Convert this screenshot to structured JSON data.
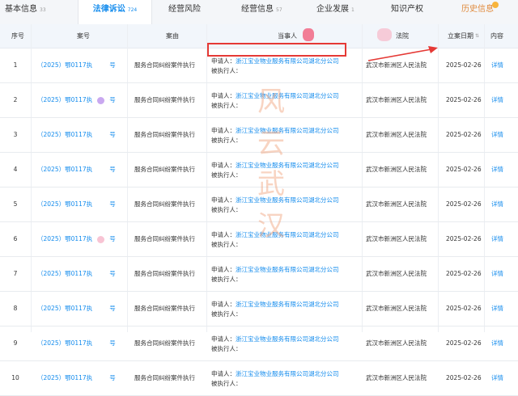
{
  "tabs": [
    {
      "label": "基本信息",
      "count": "33"
    },
    {
      "label": "法律诉讼",
      "count": "724"
    },
    {
      "label": "经营风险",
      "count": ""
    },
    {
      "label": "经营信息",
      "count": "57"
    },
    {
      "label": "企业发展",
      "count": "1"
    },
    {
      "label": "知识产权",
      "count": ""
    },
    {
      "label": "历史信息",
      "count": ""
    }
  ],
  "table": {
    "headers": {
      "index": "序号",
      "case_no": "案号",
      "cause": "案由",
      "parties": "当事人",
      "court": "法院",
      "date": "立案日期",
      "content": "内容"
    },
    "rows": [
      {
        "index": "1",
        "case_no_a": "（2025）鄂0117执",
        "case_no_b": "号",
        "cause": "服务合同纠纷案件执行",
        "applicant_label": "申请人：",
        "applicant": "浙江宝业物业服务有限公司湖北分公司",
        "respondent_label": "被执行人：",
        "respondent": "",
        "court": "武汉市新洲区人民法院",
        "date": "2025-02-26",
        "action": "详情"
      },
      {
        "index": "2",
        "case_no_a": "（2025）鄂0117执",
        "case_no_b": "号",
        "cause": "服务合同纠纷案件执行",
        "applicant_label": "申请人：",
        "applicant": "浙江宝业物业服务有限公司湖北分公司",
        "respondent_label": "被执行人：",
        "respondent": "",
        "court": "武汉市新洲区人民法院",
        "date": "2025-02-26",
        "action": "详情"
      },
      {
        "index": "3",
        "case_no_a": "（2025）鄂0117执",
        "case_no_b": "号",
        "cause": "服务合同纠纷案件执行",
        "applicant_label": "申请人：",
        "applicant": "浙江宝业物业服务有限公司湖北分公司",
        "respondent_label": "被执行人：",
        "respondent": "",
        "court": "武汉市新洲区人民法院",
        "date": "2025-02-26",
        "action": "详情"
      },
      {
        "index": "4",
        "case_no_a": "（2025）鄂0117执",
        "case_no_b": "号",
        "cause": "服务合同纠纷案件执行",
        "applicant_label": "申请人：",
        "applicant": "浙江宝业物业服务有限公司湖北分公司",
        "respondent_label": "被执行人：",
        "respondent": "",
        "court": "武汉市新洲区人民法院",
        "date": "2025-02-26",
        "action": "详情"
      },
      {
        "index": "5",
        "case_no_a": "（2025）鄂0117执",
        "case_no_b": "号",
        "cause": "服务合同纠纷案件执行",
        "applicant_label": "申请人：",
        "applicant": "浙江宝业物业服务有限公司湖北分公司",
        "respondent_label": "被执行人：",
        "respondent": "",
        "court": "武汉市新洲区人民法院",
        "date": "2025-02-26",
        "action": "详情"
      },
      {
        "index": "6",
        "case_no_a": "（2025）鄂0117执",
        "case_no_b": "号",
        "cause": "服务合同纠纷案件执行",
        "applicant_label": "申请人：",
        "applicant": "浙江宝业物业服务有限公司湖北分公司",
        "respondent_label": "被执行人：",
        "respondent": "",
        "court": "武汉市新洲区人民法院",
        "date": "2025-02-26",
        "action": "详情"
      },
      {
        "index": "7",
        "case_no_a": "（2025）鄂0117执",
        "case_no_b": "号",
        "cause": "服务合同纠纷案件执行",
        "applicant_label": "申请人：",
        "applicant": "浙江宝业物业服务有限公司湖北分公司",
        "respondent_label": "被执行人：",
        "respondent": "",
        "court": "武汉市新洲区人民法院",
        "date": "2025-02-26",
        "action": "详情"
      },
      {
        "index": "8",
        "case_no_a": "（2025）鄂0117执",
        "case_no_b": "号",
        "cause": "服务合同纠纷案件执行",
        "applicant_label": "申请人：",
        "applicant": "浙江宝业物业服务有限公司湖北分公司",
        "respondent_label": "被执行人：",
        "respondent": "",
        "court": "武汉市新洲区人民法院",
        "date": "2025-02-26",
        "action": "详情"
      },
      {
        "index": "9",
        "case_no_a": "（2025）鄂0117执",
        "case_no_b": "号",
        "cause": "服务合同纠纷案件执行",
        "applicant_label": "申请人：",
        "applicant": "浙江宝业物业服务有限公司湖北分公司",
        "respondent_label": "被执行人：",
        "respondent": "",
        "court": "武汉市新洲区人民法院",
        "date": "2025-02-26",
        "action": "详情"
      },
      {
        "index": "10",
        "case_no_a": "（2025）鄂0117执",
        "case_no_b": "号",
        "cause": "服务合同纠纷案件执行",
        "applicant_label": "申请人：",
        "applicant": "浙江宝业物业服务有限公司湖北分公司",
        "respondent_label": "被执行人：",
        "respondent": "",
        "court": "武汉市新洲区人民法院",
        "date": "2025-02-26",
        "action": "详情"
      }
    ]
  },
  "watermark": [
    "风",
    "云",
    "武",
    "汉"
  ],
  "colors": {
    "link": "#128bed",
    "highlight_box": "#e53935",
    "watermark": "#f0a17a",
    "history_tab": "#e08a3c"
  }
}
